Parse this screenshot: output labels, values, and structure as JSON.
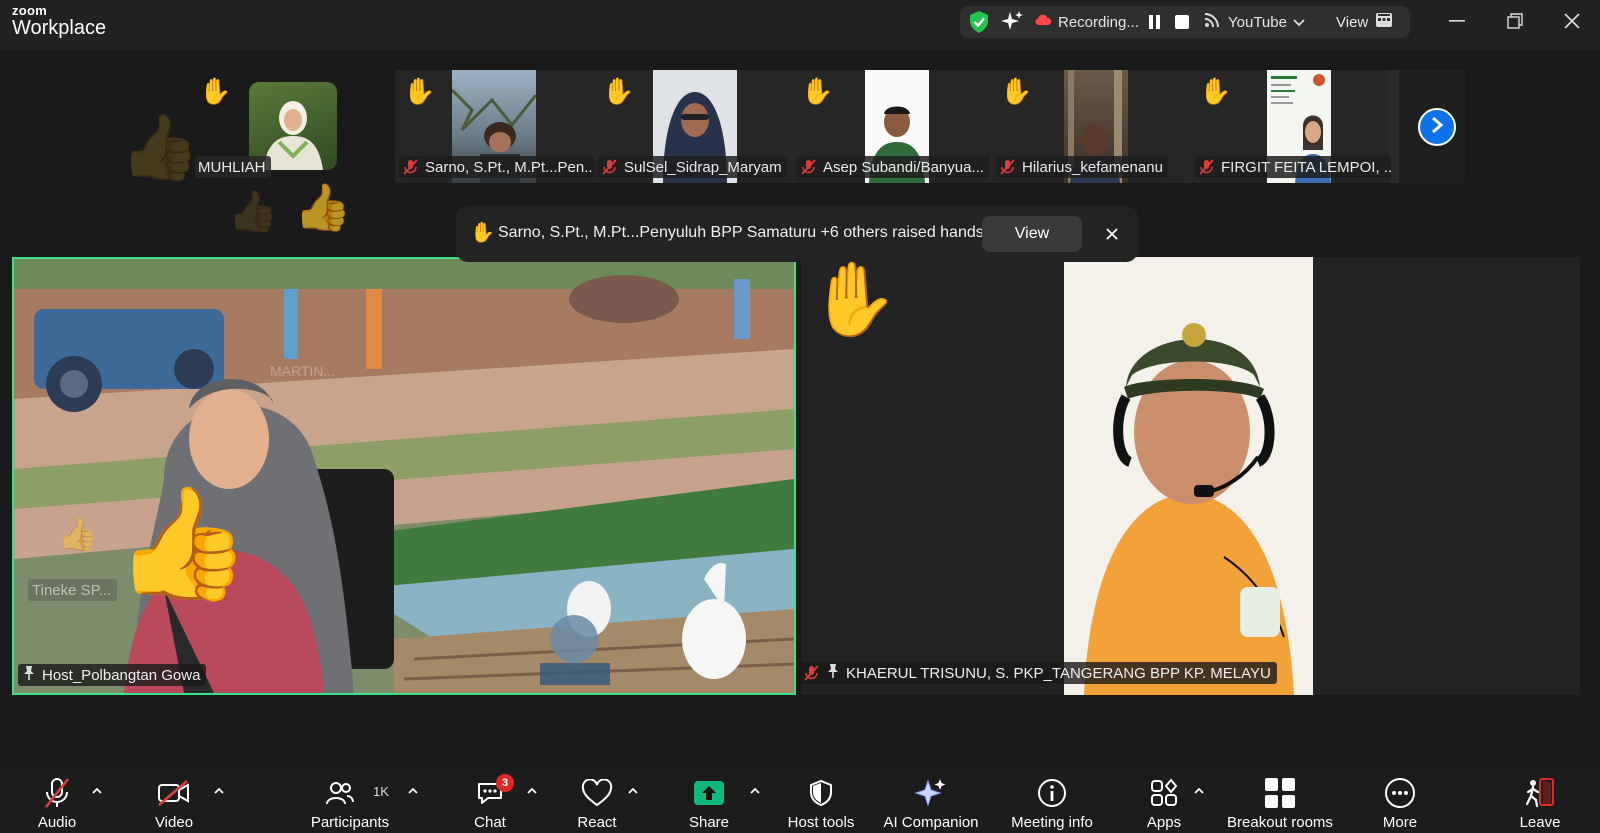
{
  "app": {
    "brand_small": "zoom",
    "brand_large": "Workplace"
  },
  "top_controls": {
    "recording_label": "Recording...",
    "stream_label": "YouTube",
    "view_label": "View"
  },
  "thumbnails": [
    {
      "name": "MUHLIAH"
    },
    {
      "name": "Sarno, S.Pt., M.Pt...Pen..."
    },
    {
      "name": "SulSel_Sidrap_Maryam"
    },
    {
      "name": "Asep Subandi/Banyua..."
    },
    {
      "name": "Hilarius_kefamenanu"
    },
    {
      "name": "FIRGIT FEITA LEMPOI, ..."
    }
  ],
  "notification": {
    "text": "Sarno, S.Pt., M.Pt...Penyuluh BPP Samaturu +6 others raised hands",
    "view_label": "View"
  },
  "main_left": {
    "name": "Host_Polbangtan Gowa",
    "overlay_names": [
      "MARTIN...",
      "Tineke SP..."
    ]
  },
  "main_right": {
    "name": "KHAERUL TRISUNU, S. PKP_TANGERANG BPP KP. MELAYU"
  },
  "toolbar": {
    "audio": "Audio",
    "video": "Video",
    "participants": "Participants",
    "participants_count": "1K",
    "chat": "Chat",
    "chat_badge": "3",
    "react": "React",
    "share": "Share",
    "host_tools": "Host tools",
    "ai_companion": "AI Companion",
    "meeting_info": "Meeting info",
    "apps": "Apps",
    "breakout_rooms": "Breakout rooms",
    "more": "More",
    "leave": "Leave"
  },
  "colors": {
    "active_speaker": "#3be18a",
    "accent": "#0e72ed",
    "share_green": "#0fb97a",
    "leave_red": "#e02828",
    "security_green": "#23c552"
  }
}
